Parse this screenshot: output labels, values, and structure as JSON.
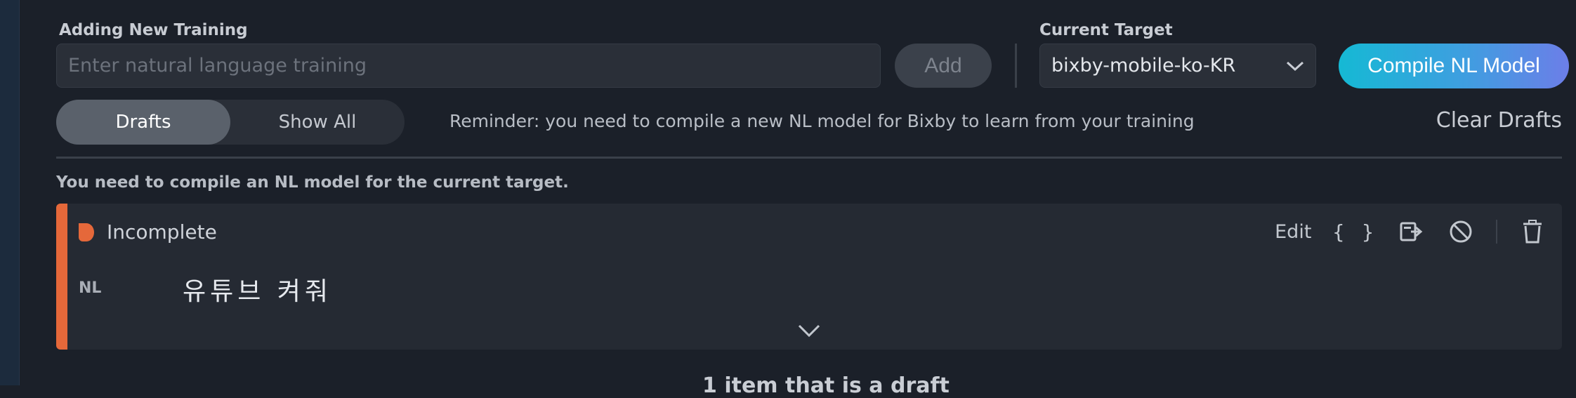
{
  "new_training": {
    "label": "Adding New Training",
    "placeholder": "Enter natural language training",
    "value": "",
    "add_label": "Add"
  },
  "target": {
    "label": "Current Target",
    "selected": "bixby-mobile-ko-KR"
  },
  "compile_label": "Compile NL Model",
  "filter_tabs": [
    {
      "label": "Drafts",
      "active": true
    },
    {
      "label": "Show All",
      "active": false
    }
  ],
  "reminder": "Reminder: you need to compile a new NL model for Bixby to learn from your training",
  "clear_drafts_label": "Clear Drafts",
  "warning": "You need to compile an NL model for the current target.",
  "training_item": {
    "status": "Incomplete",
    "status_color": "#e5683a",
    "nl_label": "NL",
    "nl_text": "유튜브 켜줘",
    "actions": {
      "edit": "Edit",
      "json": "{ }",
      "icons": [
        "export-icon",
        "disable-icon",
        "trash-icon",
        "chevron-down-icon"
      ]
    }
  },
  "footer": "1 item that is a draft",
  "colors": {
    "accent_gradient_start": "#15b9d4",
    "accent_gradient_end": "#6c7ee8",
    "incomplete": "#e5683a"
  }
}
